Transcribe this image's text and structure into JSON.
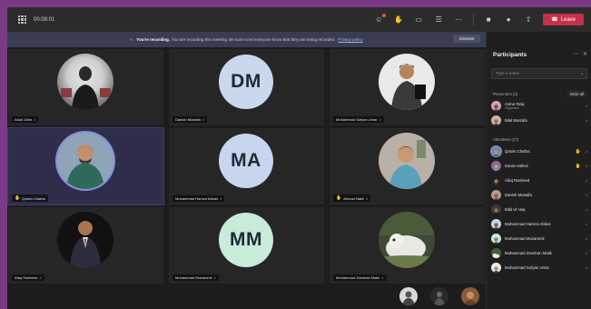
{
  "meeting": {
    "title": "00:08:01"
  },
  "toolbar": {
    "leave_label": "Leave",
    "icons": [
      "reaction-icon",
      "raise-hand-icon",
      "chat-icon",
      "participants-icon",
      "more-icon",
      "camera-icon",
      "mic-icon",
      "share-icon"
    ]
  },
  "banner": {
    "strong": "You're recording.",
    "text": "You are recording this meeting. Be sure to let everyone know that they are being recorded.",
    "policy_link": "Privacy policy",
    "dismiss_label": "Dismiss"
  },
  "tiles": [
    {
      "name": "Asad Jafar",
      "initials": "",
      "hand": false
    },
    {
      "name": "Danish Mustafa",
      "initials": "DM",
      "color": "#c9d8ef",
      "hand": false
    },
    {
      "name": "Muhammad Sufyan Umar",
      "initials": "",
      "hand": false
    },
    {
      "name": "Qasim Chatha",
      "initials": "",
      "hand": true
    },
    {
      "name": "Muhammad Hamza Abbas",
      "initials": "MA",
      "color": "#c7d6ee",
      "hand": false
    },
    {
      "name": "Ahmad Nabil",
      "initials": "",
      "hand": true
    },
    {
      "name": "Afaq Rasheed",
      "initials": "",
      "hand": false
    },
    {
      "name": "Muhammad Muzammil",
      "initials": "MM",
      "color": "#c9ebd9",
      "hand": false
    },
    {
      "name": "Muhammad Zeeshan Malik",
      "initials": "",
      "hand": false
    }
  ],
  "panel": {
    "title": "Participants",
    "search_placeholder": "Type a name",
    "presenters_label": "Presenters (2)",
    "mute_all_label": "Mute all",
    "attendees_label": "Attendees (17)",
    "participants": [
      {
        "name": "Asma Tariq",
        "sub": "Organizer",
        "hand": false
      },
      {
        "name": "Bilal Mustafa",
        "sub": "",
        "hand": false
      },
      {
        "name": "Qasim Chatha",
        "sub": "",
        "hand": true
      },
      {
        "name": "Dania Hafeez",
        "sub": "",
        "hand": true
      },
      {
        "name": "Afaq Rasheed",
        "sub": "",
        "hand": false
      },
      {
        "name": "Danish Mustafa",
        "sub": "",
        "hand": false
      },
      {
        "name": "Bilal Ul Haq",
        "sub": "",
        "hand": false
      },
      {
        "name": "Muhammad Hamza Abbas",
        "sub": "",
        "hand": false
      },
      {
        "name": "Muhammad Muzammil",
        "sub": "",
        "hand": false
      },
      {
        "name": "Muhammad Zeeshan Malik",
        "sub": "",
        "hand": false
      },
      {
        "name": "Muhammad Sufyan Umar",
        "sub": "",
        "hand": false
      }
    ]
  }
}
